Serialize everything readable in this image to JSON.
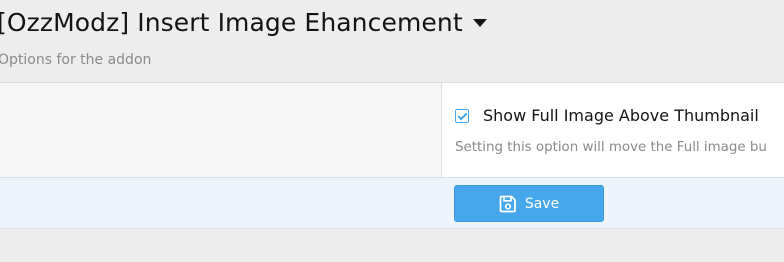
{
  "header": {
    "title": "[OzzModz] Insert Image Ehancement",
    "subtitle": "Options for the addon"
  },
  "options": {
    "show_full_image": {
      "label": "Show Full Image Above Thumbnail",
      "checked": true,
      "hint": "Setting this option will move the Full image bu"
    }
  },
  "actions": {
    "save_label": "Save"
  },
  "colors": {
    "accent": "#47a7eb",
    "submit_bar": "#edf4fb",
    "page_bg": "#ededed"
  },
  "icons": {
    "title_menu": "caret-down-icon",
    "save": "floppy-disk-icon",
    "checkbox": "check-icon"
  }
}
